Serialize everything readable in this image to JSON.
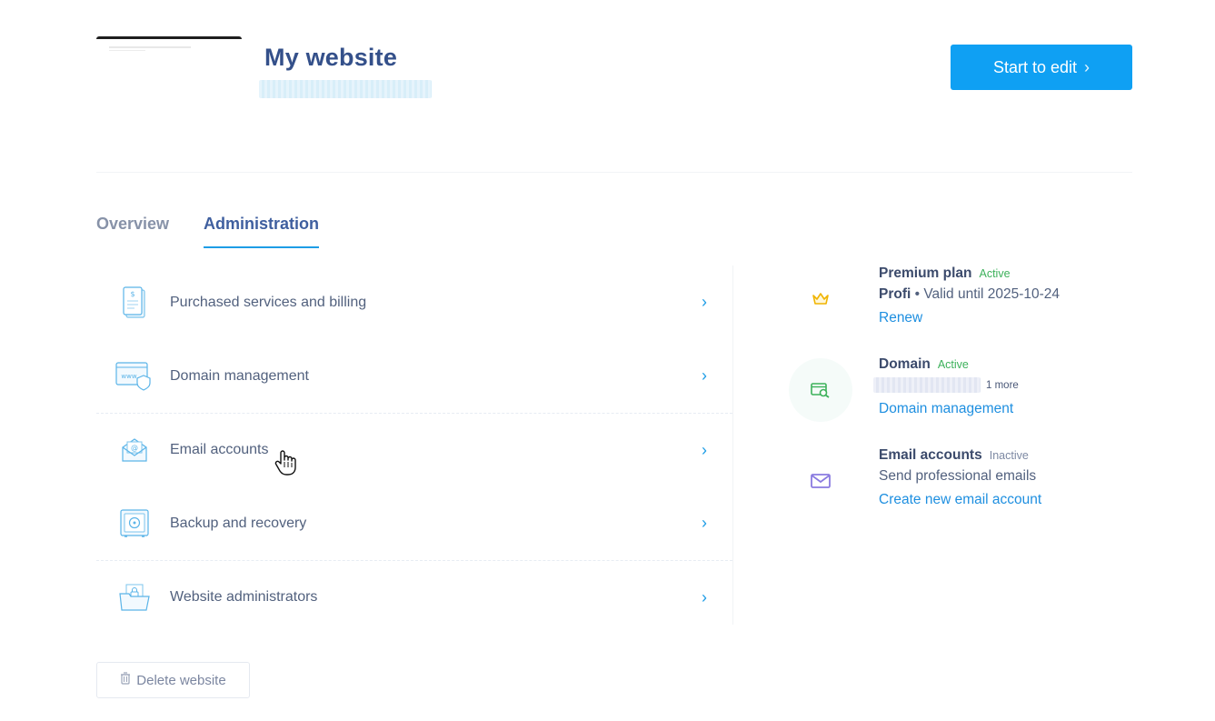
{
  "header": {
    "site_title": "My website",
    "edit_button_label": "Start to edit",
    "edit_button_chevron": "›"
  },
  "tabs": [
    {
      "label": "Overview",
      "active": false
    },
    {
      "label": "Administration",
      "active": true
    }
  ],
  "menu": {
    "items": [
      {
        "label": "Purchased services and billing",
        "icon": "invoice-icon"
      },
      {
        "label": "Domain management",
        "icon": "www-shield-icon"
      },
      {
        "label": "Email accounts",
        "icon": "envelope-at-icon"
      },
      {
        "label": "Backup and recovery",
        "icon": "safe-icon"
      },
      {
        "label": "Website administrators",
        "icon": "folder-lock-icon"
      }
    ],
    "arrow": "›"
  },
  "side": {
    "plan": {
      "title": "Premium plan",
      "status": "Active",
      "plan_name": "Profi",
      "validity": " • Valid until 2025-10-24",
      "link": "Renew",
      "icon": "crown-icon",
      "icon_color": "#f0b400"
    },
    "domain": {
      "title": "Domain",
      "status": "Active",
      "more": "1 more",
      "link": "Domain management",
      "icon": "domain-search-icon",
      "icon_color": "#3db15b"
    },
    "email": {
      "title": "Email accounts",
      "status": "Inactive",
      "sub": "Send professional emails",
      "link": "Create new email account",
      "icon": "mail-icon",
      "icon_color": "#8a7be0"
    }
  },
  "footer": {
    "delete_label": "Delete website",
    "delete_icon": "trash-icon"
  },
  "colors": {
    "accent": "#0fa0f3",
    "link": "#1e8fe0",
    "title": "#34508a",
    "active": "#3db15b"
  }
}
